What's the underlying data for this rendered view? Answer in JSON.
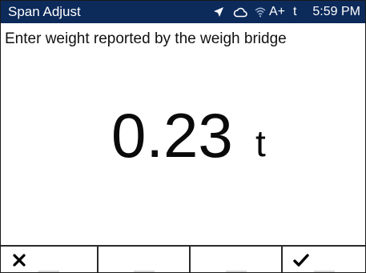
{
  "status_bar": {
    "title": "Span Adjust",
    "background_color": "#0c2a5a",
    "icons": [
      "navigation-arrow-icon",
      "cloud-icon",
      "wifi-icon"
    ],
    "battery_label": "A+",
    "unit_indicator": "t",
    "time": "5:59 PM"
  },
  "prompt": {
    "text": "Enter weight reported by the weigh bridge"
  },
  "value_display": {
    "value": "0.23",
    "unit": "t"
  },
  "softkeys": [
    {
      "name": "cancel",
      "icon": "close-icon",
      "label": ""
    },
    {
      "name": "blank-2",
      "icon": "",
      "label": ""
    },
    {
      "name": "blank-3",
      "icon": "",
      "label": ""
    },
    {
      "name": "confirm",
      "icon": "checkmark-icon",
      "label": ""
    }
  ]
}
